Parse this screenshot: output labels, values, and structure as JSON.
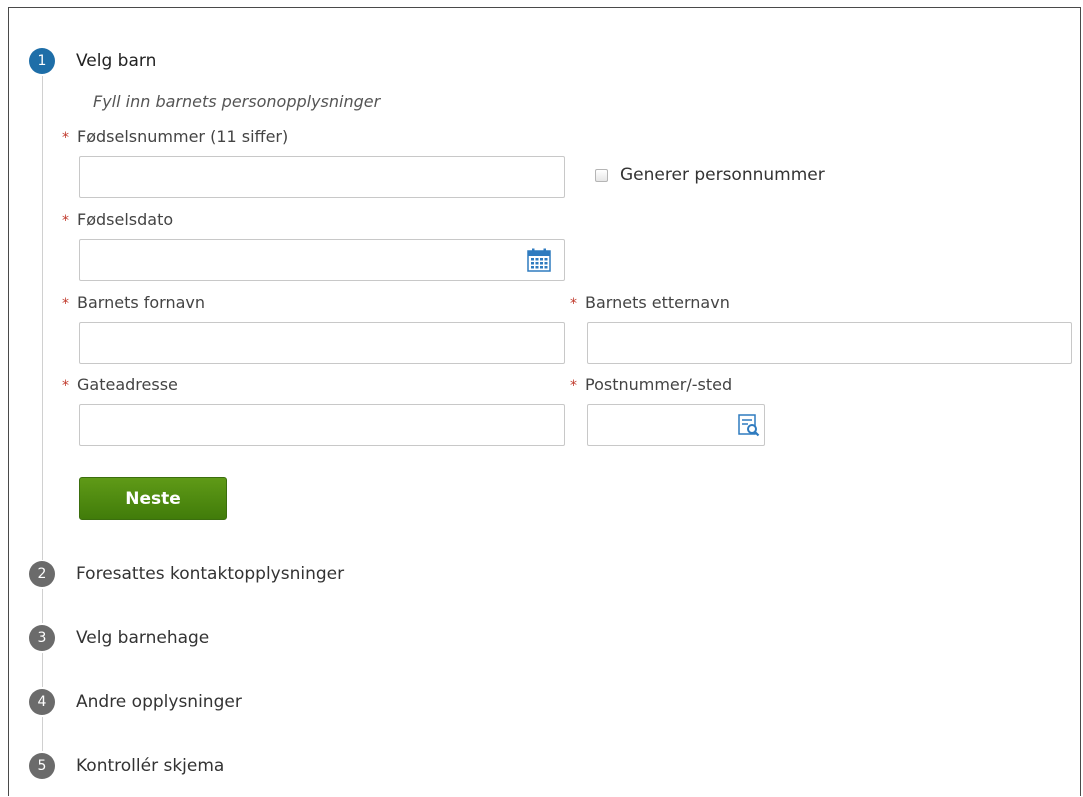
{
  "steps": [
    {
      "number": "1",
      "title": "Velg barn",
      "state": "active"
    },
    {
      "number": "2",
      "title": "Foresattes kontaktopplysninger",
      "state": "inactive"
    },
    {
      "number": "3",
      "title": "Velg barnehage",
      "state": "inactive"
    },
    {
      "number": "4",
      "title": "Andre opplysninger",
      "state": "inactive"
    },
    {
      "number": "5",
      "title": "Kontrollér skjema",
      "state": "inactive"
    }
  ],
  "form": {
    "intro": "Fyll inn barnets personopplysninger",
    "required_marker": "*",
    "fodselsnummer": {
      "label": "Fødselsnummer (11 siffer)",
      "value": "",
      "placeholder": ""
    },
    "generer_checkbox": {
      "label": "Generer personnummer",
      "checked": false
    },
    "fodselsdato": {
      "label": "Fødselsdato",
      "value": "",
      "icon": "calendar-icon"
    },
    "fornavn": {
      "label": "Barnets fornavn",
      "value": ""
    },
    "etternavn": {
      "label": "Barnets etternavn",
      "value": ""
    },
    "gateadresse": {
      "label": "Gateadresse",
      "value": ""
    },
    "postnummer": {
      "label": "Postnummer/-sted",
      "value": "",
      "icon": "lookup-search-icon"
    },
    "next_label": "Neste"
  },
  "colors": {
    "active_step": "#1e6ea8",
    "inactive_step": "#6b6b6b",
    "required": "#c0392b",
    "button_green": "#4f8c10",
    "icon_blue": "#2f7bbf"
  }
}
